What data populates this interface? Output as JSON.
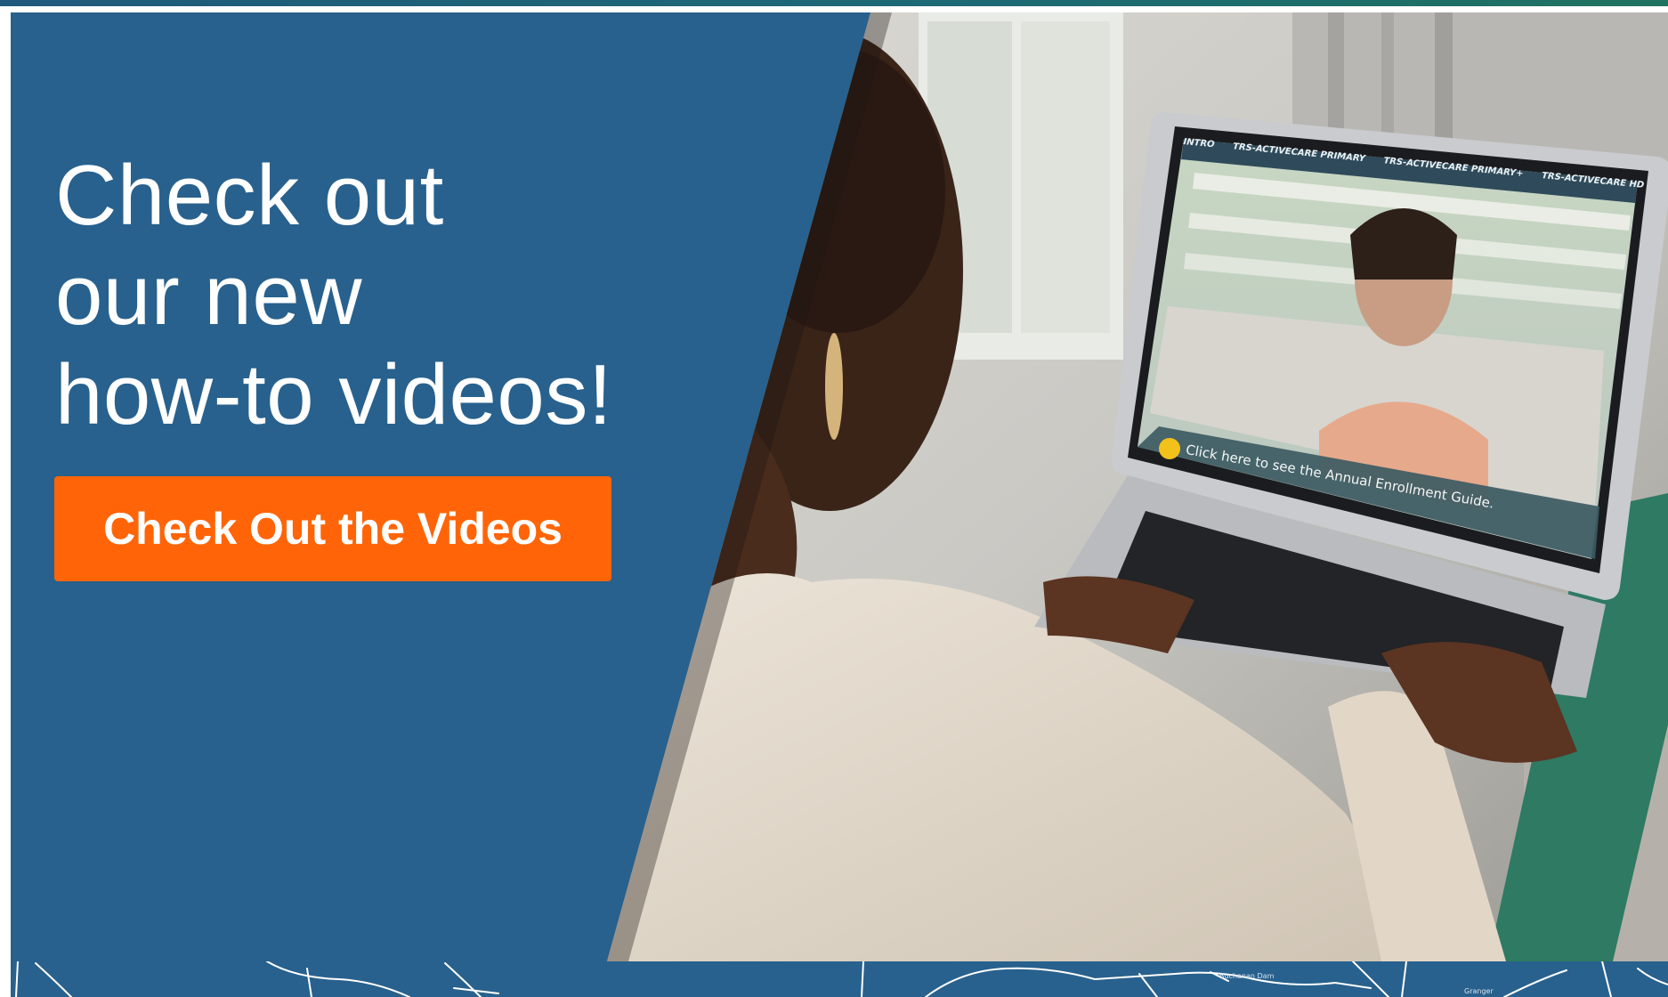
{
  "hero": {
    "headline_line1": "Check out",
    "headline_line2": "our new",
    "headline_line3": "how-to videos!",
    "cta_label": "Check Out the Videos"
  },
  "laptop_screen": {
    "tabs": [
      "INTRO",
      "TRS-ACTIVECARE PRIMARY",
      "TRS-ACTIVECARE PRIMARY+",
      "TRS-ACTIVECARE HD"
    ],
    "banner_text": "Click here to see the Annual Enrollment Guide."
  },
  "map": {
    "labels": [
      "Buchanan Dam",
      "Granger"
    ]
  },
  "colors": {
    "panel_blue": "#28618d",
    "cta_orange": "#ff6508",
    "top_bar": "#1f6a70"
  }
}
